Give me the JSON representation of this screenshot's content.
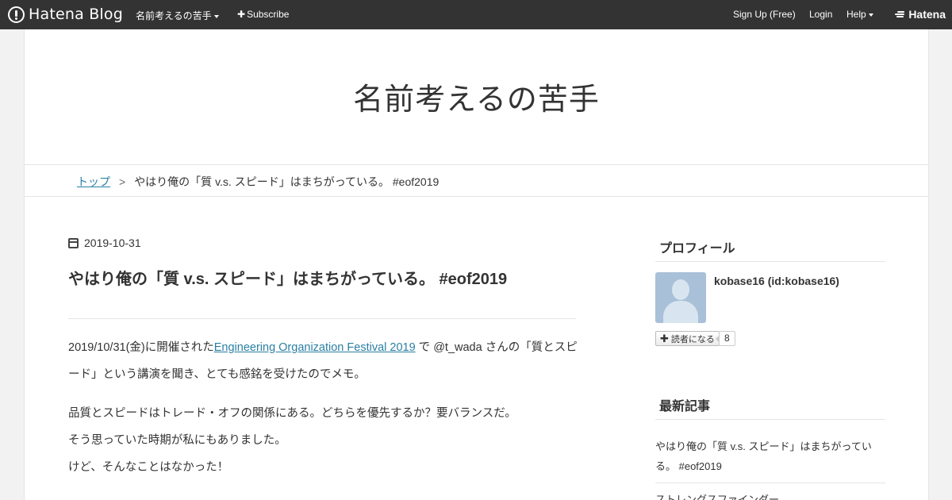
{
  "topbar": {
    "logo_text": "Hatena Blog",
    "blog_menu": "名前考えるの苦手",
    "subscribe": "Subscribe",
    "signup": "Sign Up (Free)",
    "login": "Login",
    "help": "Help",
    "brand": "Hatena"
  },
  "blog": {
    "title": "名前考えるの苦手"
  },
  "breadcrumb": {
    "home": "トップ",
    "separator": ">",
    "current": "やはり俺の「質 v.s. スピード」はまちがっている。 #eof2019"
  },
  "article": {
    "date": "2019-10-31",
    "title": "やはり俺の「質 v.s. スピード」はまちがっている。 #eof2019",
    "p1_before": "2019/10/31(金)に開催された",
    "p1_link": "Engineering Organization Festival 2019",
    "p1_after": " で @t_wada さんの「質とスピード」という講演を聞き、とても感銘を受けたのでメモ。",
    "p2_line1": "品質とスピードはトレード・オフの関係にある。どちらを優先するか？要バランスだ。",
    "p2_line2": "そう思っていた時期が私にもありました。",
    "p2_line3": "けど、そんなことはなかった！"
  },
  "sidebar": {
    "profile_heading": "プロフィール",
    "profile_name": "kobase16 (id:kobase16)",
    "subscribe_label": "読者になる",
    "subscriber_count": "8",
    "recent_heading": "最新記事",
    "recent": [
      "やはり俺の「質 v.s. スピード」はまちがっている。 #eof2019",
      "ストレングスファインダー"
    ]
  }
}
